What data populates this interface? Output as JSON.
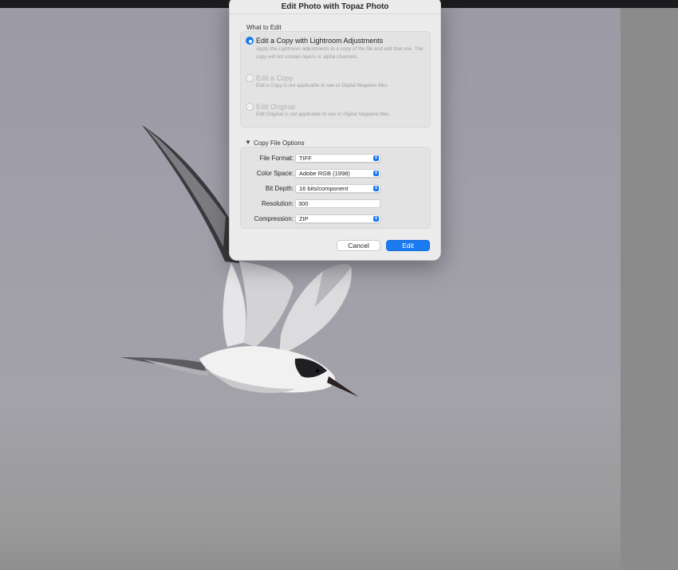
{
  "dialog": {
    "title": "Edit Photo with Topaz Photo",
    "what_to_edit": {
      "label": "What to Edit",
      "options": [
        {
          "label": "Edit a Copy with Lightroom Adjustments",
          "description": "Apply the Lightroom adjustments to a copy of the file and edit that one. The copy will not contain layers or alpha channels.",
          "selected": true,
          "enabled": true
        },
        {
          "label": "Edit a Copy",
          "description": "Edit a Copy is not applicable to raw or Digital Negative files.",
          "selected": false,
          "enabled": false
        },
        {
          "label": "Edit Original",
          "description": "Edit Original is not applicable to raw or Digital Negative files.",
          "selected": false,
          "enabled": false
        }
      ]
    },
    "copy_file_options": {
      "label": "Copy File Options",
      "disclosure": "▼",
      "file_format": {
        "label": "File Format:",
        "value": "TIFF"
      },
      "color_space": {
        "label": "Color Space:",
        "value": "Adobe RGB (1998)"
      },
      "bit_depth": {
        "label": "Bit Depth:",
        "value": "16 bits/component"
      },
      "resolution": {
        "label": "Resolution:",
        "value": "300"
      },
      "compression": {
        "label": "Compression:",
        "value": "ZIP"
      }
    },
    "buttons": {
      "cancel": "Cancel",
      "edit": "Edit"
    },
    "accent_color": "#1a7af0"
  },
  "icons": {
    "popup_arrow": "⬍"
  }
}
